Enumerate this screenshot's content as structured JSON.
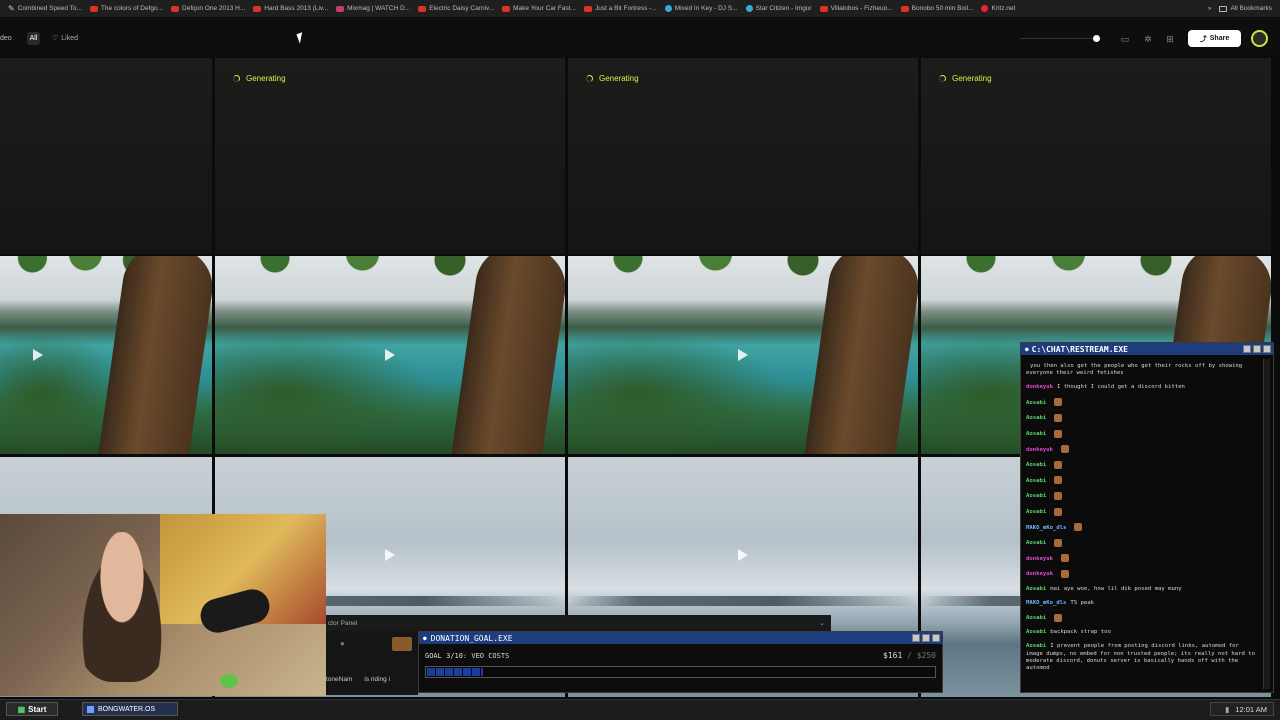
{
  "bookmarks": {
    "items": [
      {
        "label": "Combined Speed To...",
        "icon": "pen-icon"
      },
      {
        "label": "The colors of Defgo...",
        "icon": "youtube-icon"
      },
      {
        "label": "Defqon One 2013 H...",
        "icon": "youtube-icon"
      },
      {
        "label": "Hard Bass 2013 (Liv...",
        "icon": "youtube-icon"
      },
      {
        "label": "Mixmag | WATCH D...",
        "icon": "mixmag-icon"
      },
      {
        "label": "Electric Daisy Carniv...",
        "icon": "youtube-icon"
      },
      {
        "label": "Make Your Car Fast...",
        "icon": "youtube-icon"
      },
      {
        "label": "Just a Bit Fortress -...",
        "icon": "youtube-icon"
      },
      {
        "label": "Mixed In Key - DJ S...",
        "icon": "mixedinkey-icon"
      },
      {
        "label": "Star Citizen - Imgur",
        "icon": "imgur-icon"
      },
      {
        "label": "Villalobos - Fizheuo...",
        "icon": "youtube-icon"
      },
      {
        "label": "Bonobo 50 min Boil...",
        "icon": "youtube-icon"
      },
      {
        "label": "Kritz.net",
        "icon": "kritz-icon"
      }
    ],
    "more": "»",
    "all_bookmarks": "All Bookmarks"
  },
  "header": {
    "filter_video": "deo",
    "filter_all": "All",
    "filter_liked": "Liked",
    "share": "Share"
  },
  "grid": {
    "generating_label": "Generating"
  },
  "ctrl_panel": {
    "title": "ctor Panel",
    "ticker_user": "toneNam",
    "ticker_text": "is riding i"
  },
  "donation": {
    "title": "DONATION_GOAL.EXE",
    "goal": "GOAL 3/10: VEO COSTS",
    "raised": "$161",
    "target": "/ $250",
    "progress_fraction": 0.11
  },
  "chat": {
    "title": "C:\\CHAT\\RESTREAM.EXE",
    "lines": [
      {
        "user": "",
        "text": "you then also get the people who get their rocks off by showing everyone their weird fetishes",
        "color": "green",
        "emote": false
      },
      {
        "user": "donkeyuk",
        "text": "I thought I could get a discord kitten",
        "color": "pink",
        "emote": false
      },
      {
        "user": "Aosabi",
        "text": "",
        "color": "green",
        "emote": true
      },
      {
        "user": "Aosabi",
        "text": "",
        "color": "green",
        "emote": true
      },
      {
        "user": "Aosabi",
        "text": "",
        "color": "green",
        "emote": true
      },
      {
        "user": "donkeyuk",
        "text": "",
        "color": "pink",
        "emote": true
      },
      {
        "user": "Aosabi",
        "text": "",
        "color": "green",
        "emote": true
      },
      {
        "user": "Aosabi",
        "text": "",
        "color": "green",
        "emote": true
      },
      {
        "user": "Aosabi",
        "text": "",
        "color": "green",
        "emote": true
      },
      {
        "user": "Aosabi",
        "text": "",
        "color": "green",
        "emote": true
      },
      {
        "user": "MAKO_mKo_dls",
        "text": "",
        "color": "blue",
        "emote": true
      },
      {
        "user": "Aosabi",
        "text": "",
        "color": "green",
        "emote": true
      },
      {
        "user": "donkeyuk",
        "text": "",
        "color": "pink",
        "emote": true
      },
      {
        "user": "donkeyuk",
        "text": "",
        "color": "pink",
        "emote": true
      },
      {
        "user": "Aosabi",
        "text": "mai aye woe, how lil dik posed may muny",
        "color": "green",
        "emote": false
      },
      {
        "user": "MAKO_mKo_dls",
        "text": "TS peak",
        "color": "blue",
        "emote": false
      },
      {
        "user": "Aosabi",
        "text": "",
        "color": "green",
        "emote": true
      },
      {
        "user": "Aosabi",
        "text": "backpack strap too",
        "color": "green",
        "emote": false
      },
      {
        "user": "Aosabi",
        "text": "I prevent people from posting discord links, automod for image dumps, no embed for non trusted people; its really not hard to moderate discord, donuts server is basically hands off with the automod",
        "color": "green",
        "emote": false
      }
    ]
  },
  "taskbar": {
    "start": "Start",
    "task": "BONGWATER.OS",
    "clock": "12:01 AM"
  },
  "colors": {
    "accent": "#d7f04b",
    "titlebar_blue": "#1d3d7e",
    "chat_green": "#55d46b"
  }
}
